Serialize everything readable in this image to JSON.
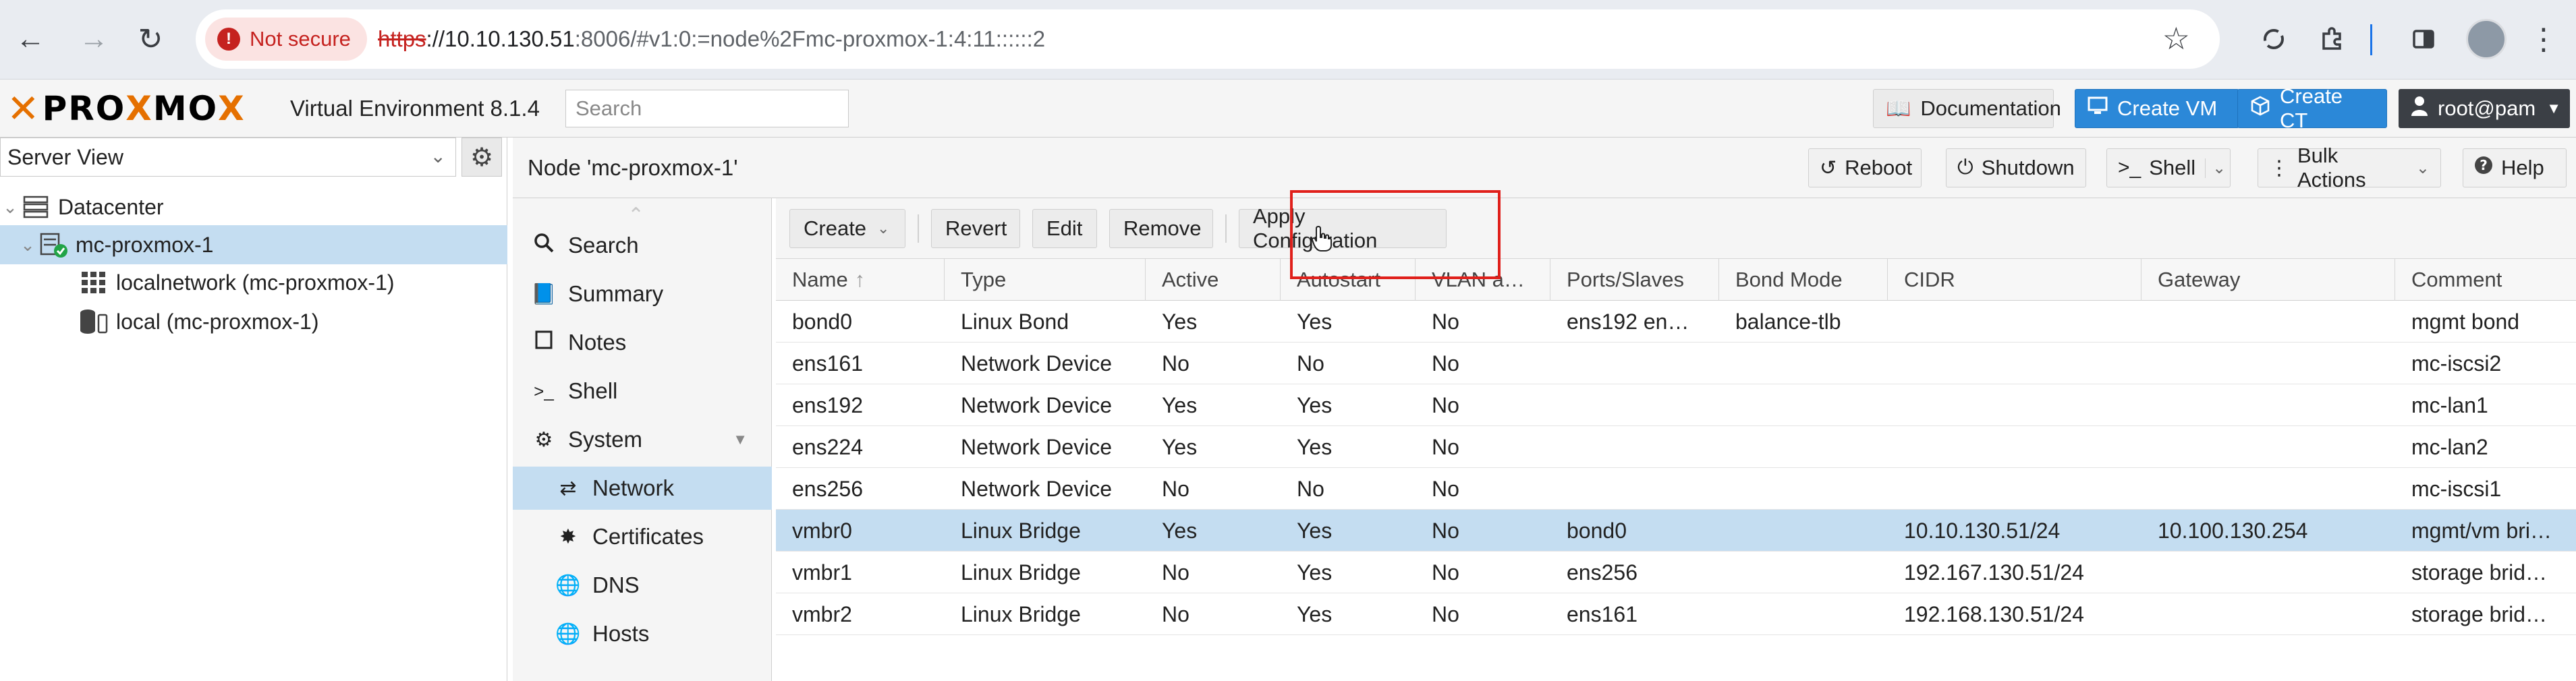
{
  "browser": {
    "not_secure": "Not secure",
    "url_scheme": "https",
    "url_host": "://10.10.130.51",
    "url_rest": ":8006/#v1:0:=node%2Fmc-proxmox-1:4:11::::::2"
  },
  "header": {
    "logo_a": "PRO",
    "logo_b": "MO",
    "version": "Virtual Environment 8.1.4",
    "search_placeholder": "Search",
    "documentation": "Documentation",
    "create_vm": "Create VM",
    "create_ct": "Create CT",
    "user": "root@pam"
  },
  "tree": {
    "view": "Server View",
    "items": [
      {
        "label": "Datacenter"
      },
      {
        "label": "mc-proxmox-1"
      },
      {
        "label": "localnetwork (mc-proxmox-1)"
      },
      {
        "label": "local (mc-proxmox-1)"
      }
    ]
  },
  "node": {
    "title": "Node 'mc-proxmox-1'",
    "reboot": "Reboot",
    "shutdown": "Shutdown",
    "shell": "Shell",
    "bulk": "Bulk Actions",
    "help": "Help"
  },
  "menu": {
    "items": [
      {
        "label": "Search"
      },
      {
        "label": "Summary"
      },
      {
        "label": "Notes"
      },
      {
        "label": "Shell"
      },
      {
        "label": "System"
      },
      {
        "label": "Network"
      },
      {
        "label": "Certificates"
      },
      {
        "label": "DNS"
      },
      {
        "label": "Hosts"
      }
    ]
  },
  "network": {
    "toolbar": {
      "create": "Create",
      "revert": "Revert",
      "edit": "Edit",
      "remove": "Remove",
      "apply": "Apply Configuration"
    },
    "columns": [
      "Name",
      "Type",
      "Active",
      "Autostart",
      "VLAN a…",
      "Ports/Slaves",
      "Bond Mode",
      "CIDR",
      "Gateway",
      "Comment"
    ],
    "rows": [
      [
        "bond0",
        "Linux Bond",
        "Yes",
        "Yes",
        "No",
        "ens192 en…",
        "balance-tlb",
        "",
        "",
        "mgmt bond"
      ],
      [
        "ens161",
        "Network Device",
        "No",
        "No",
        "No",
        "",
        "",
        "",
        "",
        "mc-iscsi2"
      ],
      [
        "ens192",
        "Network Device",
        "Yes",
        "Yes",
        "No",
        "",
        "",
        "",
        "",
        "mc-lan1"
      ],
      [
        "ens224",
        "Network Device",
        "Yes",
        "Yes",
        "No",
        "",
        "",
        "",
        "",
        "mc-lan2"
      ],
      [
        "ens256",
        "Network Device",
        "No",
        "No",
        "No",
        "",
        "",
        "",
        "",
        "mc-iscsi1"
      ],
      [
        "vmbr0",
        "Linux Bridge",
        "Yes",
        "Yes",
        "No",
        "bond0",
        "",
        "10.10.130.51/24",
        "10.100.130.254",
        "mgmt/vm bri…"
      ],
      [
        "vmbr1",
        "Linux Bridge",
        "No",
        "Yes",
        "No",
        "ens256",
        "",
        "192.167.130.51/24",
        "",
        "storage brid…"
      ],
      [
        "vmbr2",
        "Linux Bridge",
        "No",
        "Yes",
        "No",
        "ens161",
        "",
        "192.168.130.51/24",
        "",
        "storage brid…"
      ]
    ]
  },
  "colors": {
    "accent": "#2b88d8",
    "selection": "#c4ddf1",
    "highlight": "#e0201b",
    "logo_orange": "#e57000"
  }
}
